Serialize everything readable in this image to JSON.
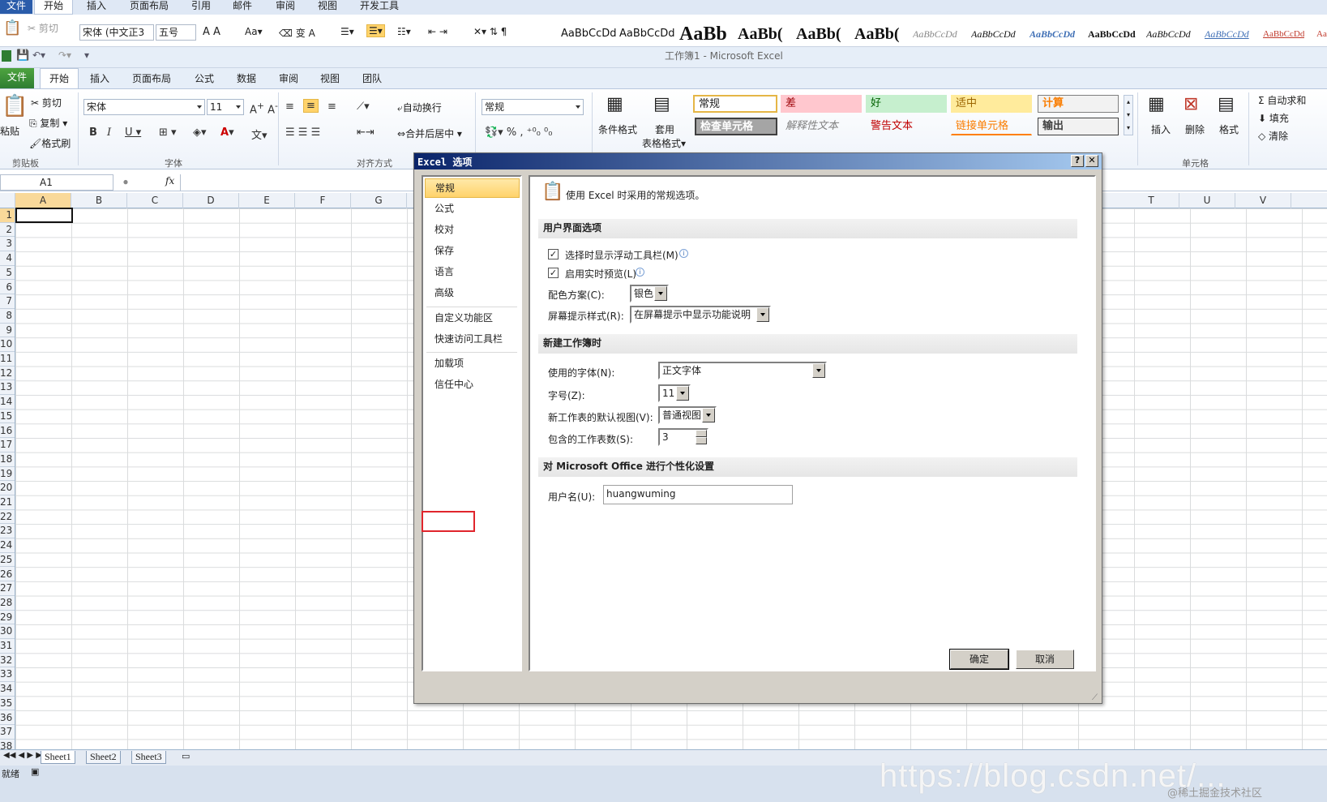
{
  "word": {
    "tabs": [
      "文件",
      "开始",
      "插入",
      "页面布局",
      "引用",
      "邮件",
      "审阅",
      "视图",
      "开发工具"
    ],
    "cut_label": "剪切",
    "font": "宋体 (中文正3",
    "size": "五号",
    "styles": [
      "AaBbCcDd",
      "AaBbCcDd",
      "AaBb",
      "AaBb(",
      "AaBb(",
      "AaBb(",
      "AaBbCcDd",
      "AaBbCcDd",
      "AaBbCcDd",
      "AaBbCcDd",
      "AaBbCcDd",
      "AaBbCcDd",
      "AaBbCcDd",
      "Aa"
    ]
  },
  "excel": {
    "window_title": "工作簿1 - Microsoft Excel",
    "tabs": [
      "文件",
      "开始",
      "插入",
      "页面布局",
      "公式",
      "数据",
      "审阅",
      "视图",
      "团队"
    ],
    "clipboard": {
      "paste": "粘贴",
      "cut": "剪切",
      "copy": "复制",
      "format_painter": "格式刷",
      "group": "剪贴板"
    },
    "font": {
      "name": "宋体",
      "size": "11",
      "group": "字体"
    },
    "alignment": {
      "wrap": "自动换行",
      "merge": "合并后居中",
      "group": "对齐方式"
    },
    "number": {
      "format": "常规"
    },
    "styles": {
      "conditional": "条件格式",
      "table": "套用",
      "table2": "表格格式",
      "cells": [
        "常规",
        "差",
        "好",
        "适中",
        "计算",
        "检查单元格",
        "解释性文本",
        "警告文本",
        "链接单元格",
        "输出"
      ]
    },
    "cells_group": {
      "insert": "插入",
      "delete": "删除",
      "format": "格式",
      "group": "单元格"
    },
    "editing": {
      "autosum": "自动求和",
      "fill": "填充",
      "clear": "清除"
    },
    "namebox": "A1",
    "fx": "fx",
    "columns": [
      "A",
      "B",
      "C",
      "D",
      "E",
      "F",
      "G",
      "T",
      "U",
      "V"
    ],
    "rows": [
      "1",
      "2",
      "3",
      "4",
      "5",
      "6",
      "7",
      "8",
      "9",
      "10",
      "11",
      "12",
      "13",
      "14",
      "15",
      "16",
      "17",
      "18",
      "19",
      "20",
      "21",
      "22",
      "23",
      "24",
      "25",
      "26",
      "27",
      "28",
      "29",
      "30",
      "31",
      "32",
      "33",
      "34",
      "35",
      "36",
      "37",
      "38"
    ],
    "sheets": [
      "Sheet1",
      "Sheet2",
      "Sheet3"
    ],
    "status": "就绪"
  },
  "dialog": {
    "title": "Excel 选项",
    "help_btn": "?",
    "close_btn": "✕",
    "nav": [
      "常规",
      "公式",
      "校对",
      "保存",
      "语言",
      "高级",
      "自定义功能区",
      "快速访问工具栏",
      "加载项",
      "信任中心"
    ],
    "header_text": "使用 Excel 时采用的常规选项。",
    "sections": {
      "ui": "用户界面选项",
      "new_wb": "新建工作簿时",
      "personalize": "对 Microsoft Office 进行个性化设置"
    },
    "ui_options": {
      "mini_toolbar": "选择时显示浮动工具栏(M)",
      "live_preview": "启用实时预览(L)",
      "color_scheme_label": "配色方案(C):",
      "color_scheme_value": "银色",
      "tooltip_label": "屏幕提示样式(R):",
      "tooltip_value": "在屏幕提示中显示功能说明"
    },
    "new_wb_options": {
      "font_label": "使用的字体(N):",
      "font_value": "正文字体",
      "size_label": "字号(Z):",
      "size_value": "11",
      "view_label": "新工作表的默认视图(V):",
      "view_value": "普通视图",
      "sheets_label": "包含的工作表数(S):",
      "sheets_value": "3"
    },
    "user": {
      "label": "用户名(U):",
      "value": "huangwuming"
    },
    "ok": "确定",
    "cancel": "取消"
  },
  "watermark": "https://blog.csdn.net/...",
  "credit": "@稀土掘金技术社区"
}
